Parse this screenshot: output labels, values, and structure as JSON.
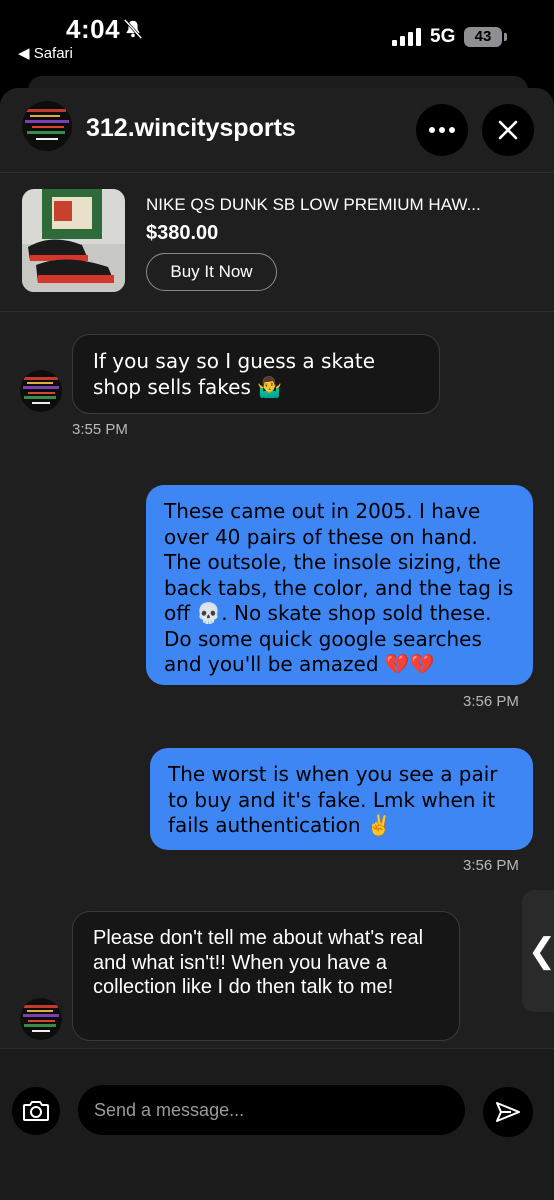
{
  "status_bar": {
    "time": "4:04",
    "back_app": "◀ Safari",
    "network": "5G",
    "battery": "43",
    "icons": [
      "bell-slash-icon",
      "signal-bars-icon",
      "battery-icon"
    ]
  },
  "header": {
    "username": "312.wincitysports",
    "more_icon": "ellipsis-icon",
    "close_icon": "close-icon"
  },
  "listing": {
    "title": "NIKE QS DUNK SB LOW PREMIUM HAW...",
    "price": "$380.00",
    "buy_label": "Buy It Now"
  },
  "messages": [
    {
      "direction": "incoming",
      "text": "If you say so I guess a skate shop sells fakes 🤷‍♂️",
      "time": "3:55 PM"
    },
    {
      "direction": "outgoing",
      "text": "These came out in 2005. I have over 40 pairs of these on hand. The outsole, the insole sizing, the back tabs, the color, and the tag is off 💀. No skate shop sold these. Do some quick google searches and you'll be amazed 💔💔",
      "time": "3:56 PM"
    },
    {
      "direction": "outgoing",
      "text": "The worst is when you see a pair to buy and it's fake. Lmk when it fails authentication ✌️",
      "time": "3:56 PM"
    },
    {
      "direction": "incoming",
      "text": "Please don't tell me about what's real and what isn't!! When you have a collection like I do then talk to me!"
    }
  ],
  "composer": {
    "placeholder": "Send a message...",
    "camera_icon": "camera-icon",
    "send_icon": "send-icon"
  },
  "side_handle": "❮",
  "colors": {
    "outgoing_bubble": "#3f86f5",
    "incoming_bubble": "#161616",
    "sheet_bg": "#1f1f1f"
  }
}
